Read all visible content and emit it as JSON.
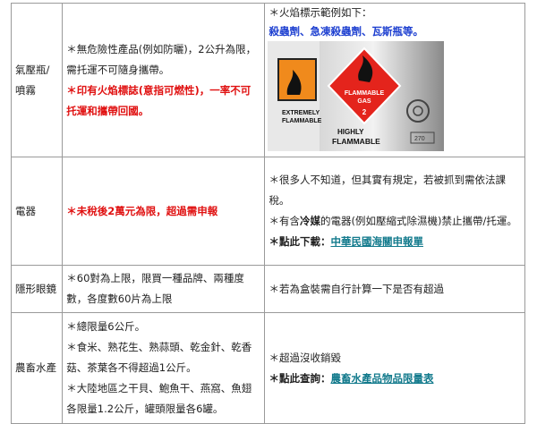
{
  "rows": [
    {
      "category": "氣壓瓶/噴霧",
      "mid_lines": [
        {
          "text": "＊無危險性產品(例如防曬)，2公升為限，需托運不可隨身攜帶。",
          "style": "normal"
        },
        {
          "text": "＊印有火焰標誌(意指可燃性)，一率不可托運和攜帶回國。",
          "style": "red"
        }
      ],
      "right_title": "＊火焰標示範例如下：",
      "right_highlight": "殺蟲劑、急凍殺蟲劑、瓦斯瓶等。",
      "photo_labels": {
        "left_top": "EXTREMELY",
        "left_bottom": "FLAMMABLE",
        "diamond_1": "FLAMMABLE",
        "diamond_2": "GAS",
        "diamond_3": "2",
        "right_top": "HIGHLY",
        "right_bottom": "FLAMMABLE",
        "corner": "270"
      }
    },
    {
      "category": "電器",
      "mid_text": "＊未稅後2萬元為限，超過需申報",
      "right_line1": "＊很多人不知道，但其實有規定，若被抓到需依法課稅。",
      "right_line2_pre": "＊有含",
      "right_line2_bold": "冷媒",
      "right_line2_post": "的電器(例如壓縮式除濕機)禁止攜帶/托運。",
      "right_line3_label": "＊點此下載：",
      "right_line3_link": "中華民國海關申報單"
    },
    {
      "category": "隱形眼鏡",
      "mid_text": "＊60對為上限，限買一種品牌、兩種度數，各度數60片為上限",
      "right_text": "＊若為盒裝需自行計算一下是否有超過"
    },
    {
      "category": "農畜水產",
      "mid_lines": [
        "＊總限量6公斤。",
        "＊食米、熟花生、熟蒜頭、乾金針、乾香菇、茶葉各不得超過1公斤。",
        "＊大陸地區之干貝、鮑魚干、燕窩、魚翅各限量1.2公斤，罐頭限量各6罐。"
      ],
      "right_line1": "＊超過沒收銷毀",
      "right_line2_label": "＊點此查詢：",
      "right_line2_link": "農畜水產品物品限量表"
    }
  ]
}
